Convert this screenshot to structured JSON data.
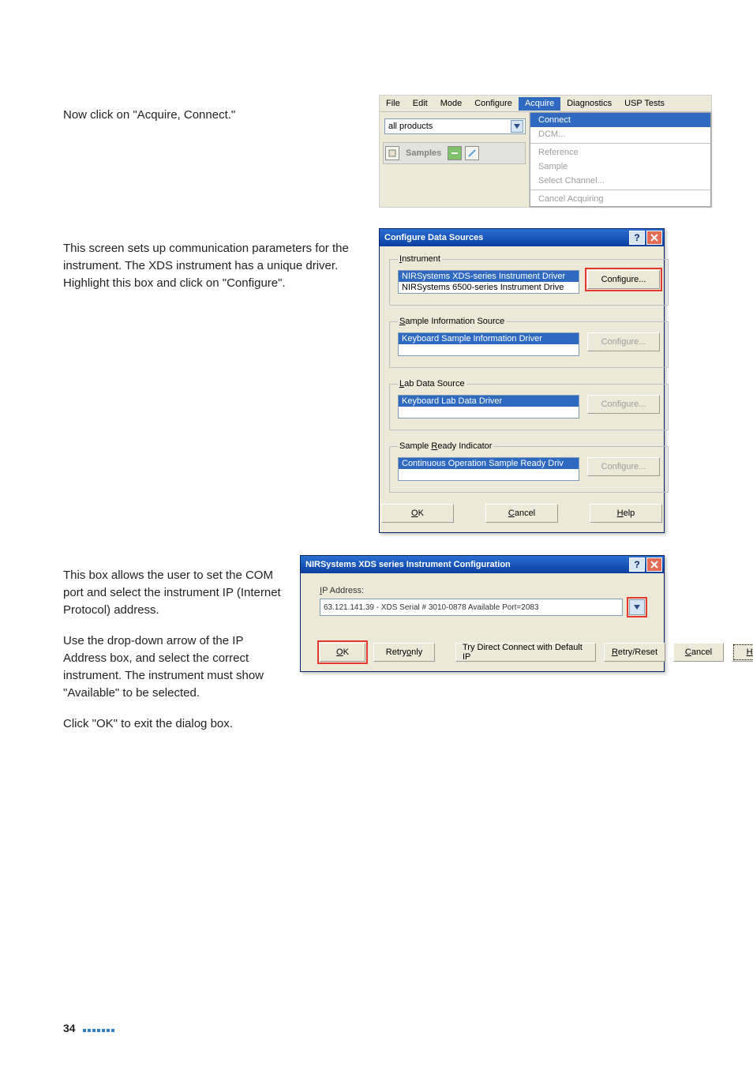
{
  "text": {
    "para1": "Now click on \"Acquire, Connect.\"",
    "para2": "This screen sets up communication parameters for the instrument. The XDS instrument has a unique driver. Highlight this box and click on \"Configure\".",
    "para3a": "This box allows the user to set the COM port and select the instrument IP (Internet Protocol) address.",
    "para3b": "Use the drop-down arrow of the IP Address box, and select the correct instrument. The instrument must show \"Available\" to be selected.",
    "para3c": "Click \"OK\" to exit the dialog box."
  },
  "menushot": {
    "menu": {
      "file": "File",
      "edit": "Edit",
      "mode": "Mode",
      "configure": "Configure",
      "acquire": "Acquire",
      "diagnostics": "Diagnostics",
      "usp": "USP Tests"
    },
    "combo_value": "all products",
    "samples_label": "Samples",
    "items": {
      "connect": "Connect",
      "dcm": "DCM...",
      "reference": "Reference",
      "sample": "Sample",
      "select_channel": "Select Channel...",
      "cancel_acq": "Cancel Acquiring"
    }
  },
  "cds": {
    "title": "Configure Data Sources",
    "group_instrument": "Instrument",
    "instrument_items": {
      "xds": "NIRSystems XDS-series Instrument Driver",
      "n6500": "NIRSystems 6500-series Instrument Drive"
    },
    "group_sample": "Sample Information Source",
    "sample_item": "Keyboard Sample Information Driver",
    "group_lab": "Lab Data Source",
    "lab_item": "Keyboard Lab Data Driver",
    "group_ready": "Sample Ready Indicator",
    "ready_item": "Continuous Operation Sample Ready Driv",
    "btn_configure": "Configure...",
    "btn_ok": "OK",
    "btn_cancel": "Cancel",
    "btn_help": "Help"
  },
  "nir": {
    "title": "NIRSystems XDS series Instrument Configuration",
    "ip_label": "IP Address:",
    "ip_value": "63.121.141.39 - XDS  Serial # 3010-0878 Available Port=2083",
    "btn_ok": "OK",
    "btn_retry_only": "Retry only",
    "btn_try_direct": "Try Direct Connect with Default IP",
    "btn_retry_reset": "Retry/Reset",
    "btn_cancel": "Cancel",
    "btn_help": "Help"
  },
  "footer": {
    "page": "34"
  }
}
